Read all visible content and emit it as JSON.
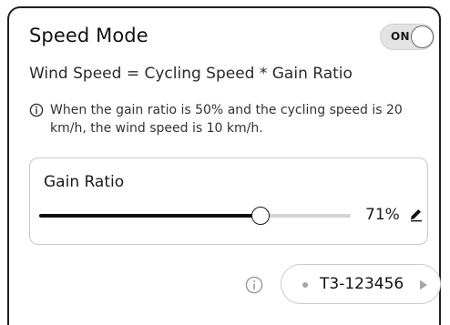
{
  "speed_mode": {
    "title": "Speed Mode",
    "toggle_label": "ON",
    "toggle_on": true,
    "formula": "Wind Speed = Cycling Speed * Gain Ratio",
    "info_icon": "info-circle-icon",
    "note": "When the gain ratio is 50% and the cycling speed is 20 km/h, the wind speed is 10 km/h."
  },
  "gain_ratio": {
    "label": "Gain Ratio",
    "value": 71,
    "value_text": "71%",
    "edit_icon": "pencil-icon"
  },
  "footer": {
    "info_icon": "info-circle-icon",
    "device_name": "T3-123456",
    "status_dot_color": "#a6a6a6",
    "play_icon": "play-triangle-icon"
  }
}
